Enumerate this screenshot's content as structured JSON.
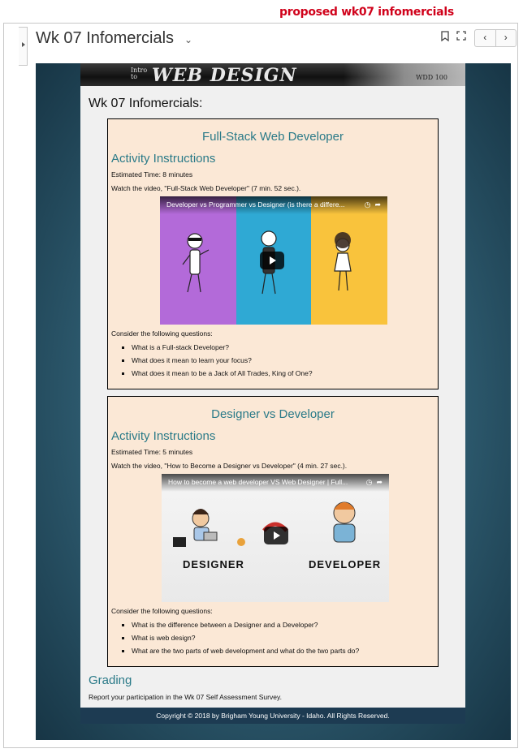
{
  "annotation": "proposed wk07 infomercials",
  "header": {
    "title": "Wk 07 Infomercials"
  },
  "banner": {
    "intro": "Intro to",
    "title": "WEB DESIGN",
    "course": "WDD 100"
  },
  "page": {
    "heading": "Wk 07  Infomercials:"
  },
  "cards": [
    {
      "title": "Full-Stack Web Developer",
      "instructions_heading": "Activity Instructions",
      "estimated_time": "Estimated Time: 8 minutes",
      "watch": "Watch the video, \"Full-Stack Web Developer\" (7 min. 52 sec.).",
      "video_title": "Developer vs Programmer vs Designer (is there a differe...",
      "questions_intro": "Consider the following questions:",
      "questions": [
        "What is a Full-stack Developer?",
        "What does it mean to learn your focus?",
        "What does it mean to be a Jack of All Trades, King of One?"
      ]
    },
    {
      "title": "Designer vs Developer",
      "instructions_heading": "Activity Instructions",
      "estimated_time": "Estimated Time: 5 minutes",
      "watch": "Watch the video, \"How to Become a Designer vs Developer\" (4 min. 27 sec.).",
      "video_title": "How to become a web developer VS Web Designer | Full...",
      "video_left_label": "DESIGNER",
      "video_right_label": "DEVELOPER",
      "questions_intro": "Consider the following questions:",
      "questions": [
        "What is the difference between a Designer and a Developer?",
        "What is web design?",
        "What are the two parts of web development and what do the two parts do?"
      ]
    }
  ],
  "grading": {
    "heading": "Grading",
    "text": "Report your participation in the Wk 07  Self Assessment Survey."
  },
  "footer": "Copyright © 2018 by Brigham Young University - Idaho. All Rights Reserved.",
  "icons": [
    "chevron-down-icon",
    "bookmark-icon",
    "fullscreen-icon",
    "chevron-left-icon",
    "chevron-right-icon",
    "clock-icon",
    "share-icon",
    "play-icon"
  ],
  "colors": {
    "accent": "#2a7a88",
    "card_bg": "#fbe8d6",
    "annotation": "#d0021b",
    "footer_bg": "#1d3b52"
  }
}
